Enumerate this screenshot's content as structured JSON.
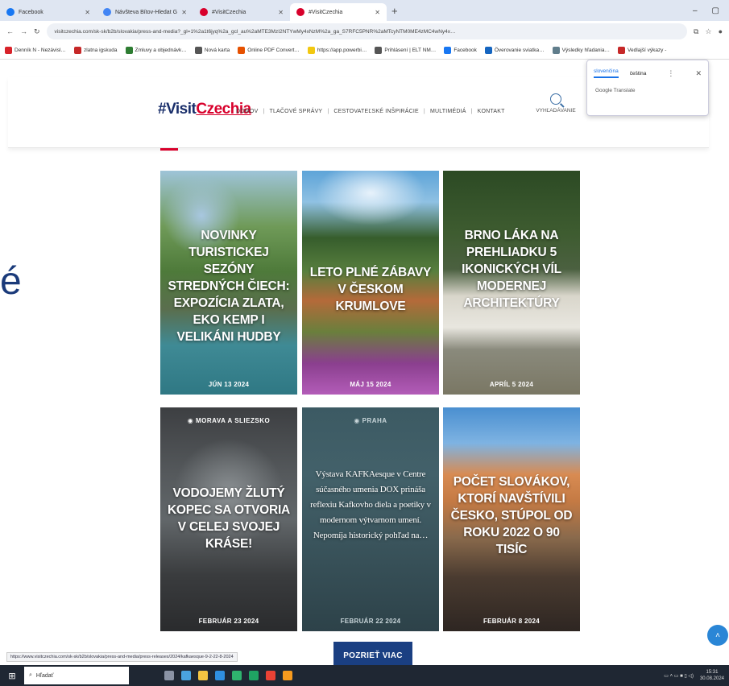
{
  "browser": {
    "tabs": [
      {
        "label": "Facebook",
        "color": "#1877f2"
      },
      {
        "label": "Návšteva Bítov-Hledat G",
        "color": "#4285f4"
      },
      {
        "label": "#VisitCzechia",
        "color": "#d8002b"
      },
      {
        "label": "#VisitCzechia",
        "color": "#d8002b",
        "active": true
      }
    ],
    "url": "visitczechia.com/sk-sk/b2b/slovakia/press-and-media?_gl=1%2a1t6jyq%2a_gcl_au%2aMTE3MzI2NTYwMy4xNzM%2a_ga_S7RFC5PNR%2aMTcyNTM0ME4zMC4wNy4x…",
    "bookmarks": [
      {
        "label": "Denník N - Nezávisl…",
        "color": "#d8232a"
      },
      {
        "label": "zlatna igskuda",
        "color": "#c62828"
      },
      {
        "label": "Zmluvy a objednávk…",
        "color": "#2e7d32"
      },
      {
        "label": "Nová karta",
        "color": "#555555"
      },
      {
        "label": "Online PDF Convert…",
        "color": "#e65100"
      },
      {
        "label": "https://app.powerbi…",
        "color": "#f2c811"
      },
      {
        "label": "Prihlásení | ELT NM…",
        "color": "#555555"
      },
      {
        "label": "Facebook",
        "color": "#1877f2"
      },
      {
        "label": "Överovanie sviatka…",
        "color": "#1565c0"
      },
      {
        "label": "Výsledky hľadania…",
        "color": "#607d8b"
      },
      {
        "label": "Vedlajší výkazy -",
        "color": "#c62828"
      }
    ]
  },
  "translate": {
    "lang_source": "slovenčina",
    "lang_target": "čeština",
    "footer": "Google Translate"
  },
  "site": {
    "logo_hash": "#Visit",
    "logo_czech": "Czechia",
    "nav": [
      "DOMOV",
      "TLAČOVÉ SPRÁVY",
      "CESTOVATEĽSKÉ INŠPIRÁCIE",
      "MULTIMÉDIÁ",
      "KONTAKT"
    ],
    "search_label": "VYHĽADÁVANIE",
    "left_glyph": "é"
  },
  "cards": [
    {
      "title": "NOVINKY TURISTICKEJ SEZÓNY STREDNÝCH ČIECH: EXPOZÍCIA ZLATA, EKO KEMP I VELIKÁNI HUDBY",
      "date": "JÚN 13 2024",
      "location": ""
    },
    {
      "title": "LETO PLNÉ ZÁBAVY V ČESKOM KRUMLOVE",
      "date": "MÁJ 15 2024",
      "location": ""
    },
    {
      "title": "BRNO LÁKA NA PREHLIADKU 5 IKONICKÝCH VÍL MODERNEJ ARCHITEKTÚRY",
      "date": "APRÍL 5 2024",
      "location": ""
    },
    {
      "title": "VODOJEMY ŽLUTÝ KOPEC SA OTVORIA V CELEJ SVOJEJ KRÁSE!",
      "date": "FEBRUÁR 23 2024",
      "location": "MORAVA A SLIEZSKO"
    },
    {
      "title": "Výstava KAFKAesque v Centre súčasného umenia DOX prináša reflexiu Kafkovho diela a poetiky v modernom výtvarnom umení. Nepomíja historický pohľad na…",
      "date": "FEBRUÁR 22 2024",
      "location": "PRAHA"
    },
    {
      "title": "POČET SLOVÁKOV, KTORÍ NAVŠTÍVILI ČESKO, STÚPOL OD ROKU 2022 O 90 TISÍC",
      "date": "FEBRUÁR 8 2024",
      "location": ""
    }
  ],
  "more_button": "POZRIEŤ VIAC",
  "status_url": "https://www.visitczechia.com/sk-sk/b2b/slovakia/press-and-media/press-releases/2024/kafkaesque-9-2-22-8-2024",
  "taskbar": {
    "search_placeholder": "Hľadať",
    "time": "15:31",
    "date": "30.08.2024"
  }
}
